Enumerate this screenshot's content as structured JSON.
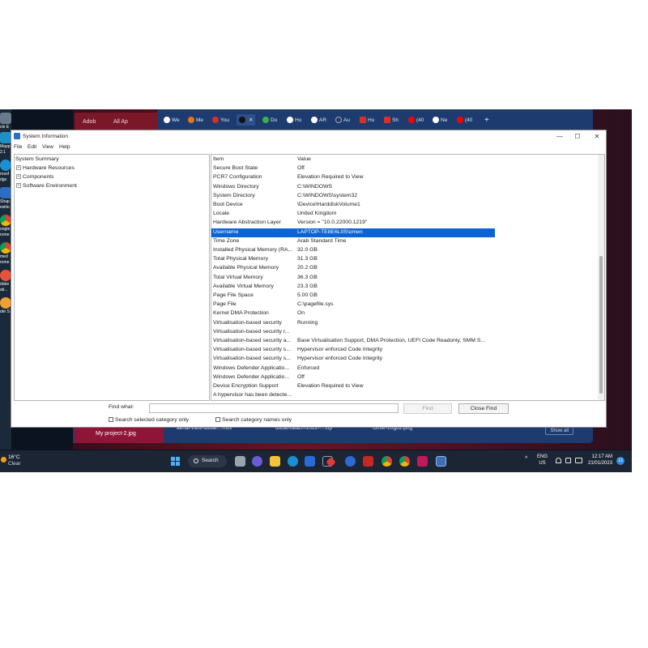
{
  "desktop": {
    "left_icons": [
      {
        "label": "cle E"
      },
      {
        "label": "d"
      },
      {
        "label": "Mapp"
      },
      {
        "label": "2.1"
      },
      {
        "label": "rosof"
      },
      {
        "label": "dge"
      },
      {
        "label": "Shap"
      },
      {
        "label": "esitio"
      },
      {
        "label": "oogle"
      },
      {
        "label": "rome"
      },
      {
        "label": "med"
      },
      {
        "label": "rome"
      },
      {
        "label": "dobe"
      },
      {
        "label": "ati..."
      },
      {
        "label": "der S"
      }
    ]
  },
  "background_windows": {
    "adobe_tabs": [
      "Adob",
      "All Ap"
    ],
    "browser_tabs": [
      "We",
      "Me",
      "You",
      "",
      "Do",
      "Ho",
      "AR",
      "Au",
      "Ho",
      "Sh",
      "(40",
      "Ne",
      "(40"
    ],
    "downloads": [
      "aerial-view-dubai....mov",
      "dubai-beach-2022-....zip",
      "Omer-Logo2.png"
    ],
    "show_all": "Show all",
    "taskbar_project": "My project-2.jpg"
  },
  "window": {
    "title": "System Information",
    "controls": {
      "minimize": "—",
      "maximize": "☐",
      "close": "✕"
    },
    "menu": [
      "File",
      "Edit",
      "View",
      "Help"
    ],
    "tree": {
      "root": "System Summary",
      "children": [
        "Hardware Resources",
        "Components",
        "Software Environment"
      ]
    },
    "table": {
      "headers": [
        "Item",
        "Value"
      ],
      "rows": [
        [
          "Secure Boot State",
          "Off"
        ],
        [
          "PCR7 Configuration",
          "Elevation Required to View"
        ],
        [
          "Windows Directory",
          "C:\\WINDOWS"
        ],
        [
          "System Directory",
          "C:\\WINDOWS\\system32"
        ],
        [
          "Boot Device",
          "\\Device\\HarddiskVolume1"
        ],
        [
          "Locale",
          "United Kingdom"
        ],
        [
          "Hardware Abstraction Layer",
          "Version = \"10.0.22000.1219\""
        ],
        [
          "Username",
          "LAPTOP-TE8E6L0S\\omen"
        ],
        [
          "Time Zone",
          "Arab Standard Time"
        ],
        [
          "Installed Physical Memory (RA...",
          "32.0 GB"
        ],
        [
          "Total Physical Memory",
          "31.3 GB"
        ],
        [
          "Available Physical Memory",
          "20.2 GB"
        ],
        [
          "Total Virtual Memory",
          "36.3 GB"
        ],
        [
          "Available Virtual Memory",
          "23.3 GB"
        ],
        [
          "Page File Space",
          "5.00 GB"
        ],
        [
          "Page File",
          "C:\\pagefile.sys"
        ],
        [
          "Kernel DMA Protection",
          "On"
        ],
        [
          "Virtualisation-based security",
          "Running"
        ],
        [
          "Virtualisation-based security r...",
          ""
        ],
        [
          "Virtualisation-based security a...",
          "Base Virtualisation Support, DMA Protection, UEFI Code Readonly, SMM S..."
        ],
        [
          "Virtualisation-based security s...",
          "Hypervisor enforced Code Integrity"
        ],
        [
          "Virtualisation-based security s...",
          "Hypervisor enforced Code Integrity"
        ],
        [
          "Windows Defender Applicatio...",
          "Enforced"
        ],
        [
          "Windows Defender Applicatio...",
          "Off"
        ],
        [
          "Device Encryption Support",
          "Elevation Required to View"
        ],
        [
          "A hypervisor has been detecte...",
          ""
        ]
      ],
      "selected_index": 7
    },
    "find": {
      "label": "Find what:",
      "value": "",
      "find_button": "Find",
      "close_find_button": "Close Find",
      "check_selected": "Search selected category only",
      "check_names": "Search category names only"
    }
  },
  "taskbar": {
    "weather_temp": "16°C",
    "weather_desc": "Clear",
    "search_label": "Search",
    "tray_up": "^",
    "lang_line1": "ENG",
    "lang_line2": "US",
    "time": "12:17 AM",
    "date": "21/01/2023",
    "notifications": "13"
  },
  "colors": {
    "selection": "#0a64d6",
    "browser_frame": "#1d3b6e",
    "taskbar": "#1c2533"
  }
}
